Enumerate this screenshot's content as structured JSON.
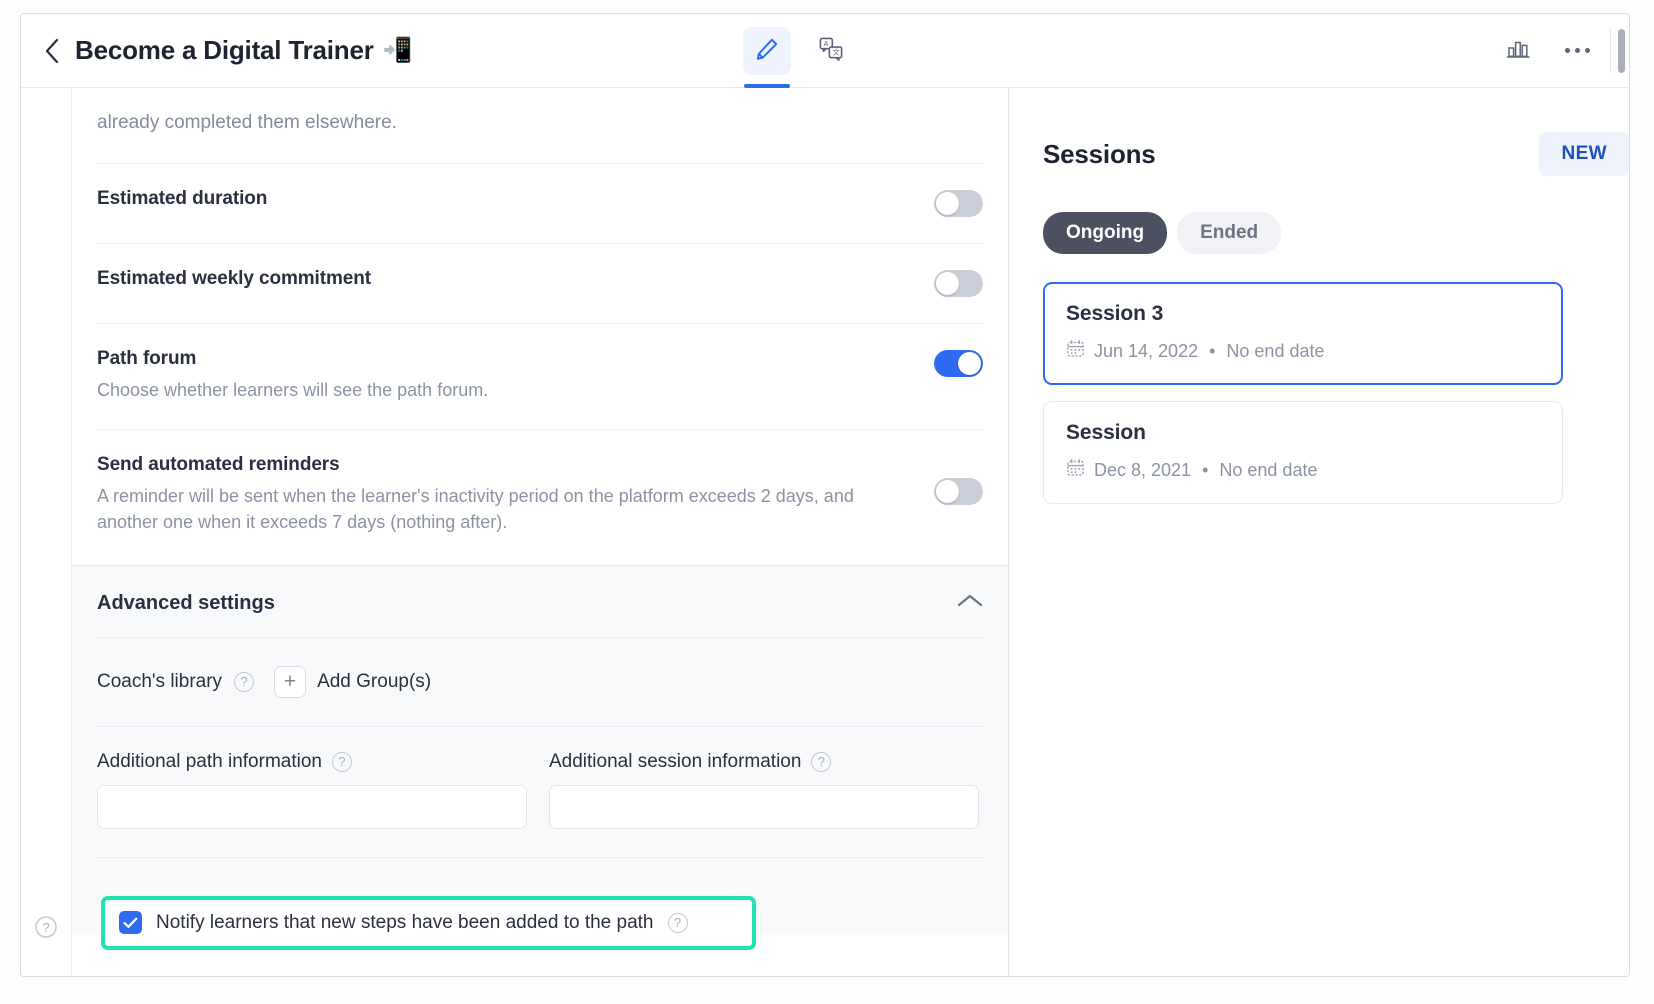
{
  "header": {
    "back_icon": "chevron-left-icon",
    "title": "Become a Digital Trainer",
    "title_emoji": "📲",
    "tabs": [
      {
        "icon": "pencil-edit-icon",
        "active": true
      },
      {
        "icon": "translate-icon",
        "active": false
      }
    ],
    "right_icons": [
      {
        "icon": "bar-chart-icon"
      },
      {
        "icon": "more-options-icon"
      }
    ]
  },
  "main": {
    "lead_text": "already completed them elsewhere.",
    "settings": [
      {
        "title": "Estimated duration",
        "desc": "",
        "toggle": "off"
      },
      {
        "title": "Estimated weekly commitment",
        "desc": "",
        "toggle": "off"
      },
      {
        "title": "Path forum",
        "desc": "Choose whether learners will see the path forum.",
        "toggle": "on"
      },
      {
        "title": "Send automated reminders",
        "desc": "A reminder will be sent when the learner's inactivity period on the platform exceeds 2 days, and another one when it exceeds 7 days (nothing after).",
        "toggle": "off"
      }
    ],
    "advanced": {
      "title": "Advanced settings",
      "collapse_icon": "chevron-up-icon",
      "coach_library_label": "Coach's library",
      "coach_library_help": "?",
      "add_groups_label": "Add Group(s)",
      "add_groups_icon": "plus-icon",
      "additional_path": {
        "label": "Additional path information",
        "help": "?",
        "value": "",
        "placeholder": ""
      },
      "additional_session": {
        "label": "Additional session information",
        "help": "?",
        "value": "",
        "placeholder": ""
      },
      "notify": {
        "label": "Notify learners that new steps have been added to the path",
        "help": "?",
        "checked": true,
        "highlight_color": "#1fe3b4"
      }
    },
    "rail_help_icon": "help-circle-icon"
  },
  "sessions": {
    "title": "Sessions",
    "new_label": "NEW",
    "filters": [
      {
        "label": "Ongoing",
        "active": true
      },
      {
        "label": "Ended",
        "active": false
      }
    ],
    "items": [
      {
        "name": "Session 3",
        "date_icon": "calendar-icon",
        "start_date": "Jun 14, 2022",
        "separator": "•",
        "end_date": "No end date",
        "selected": true
      },
      {
        "name": "Session",
        "date_icon": "calendar-icon",
        "start_date": "Dec 8, 2021",
        "separator": "•",
        "end_date": "No end date",
        "selected": false
      }
    ]
  },
  "colors": {
    "accent_blue": "#2f6bf0",
    "highlight_teal": "#1fe3b4",
    "pill_dark": "#4c5161",
    "new_btn_text": "#1e4fc0"
  }
}
